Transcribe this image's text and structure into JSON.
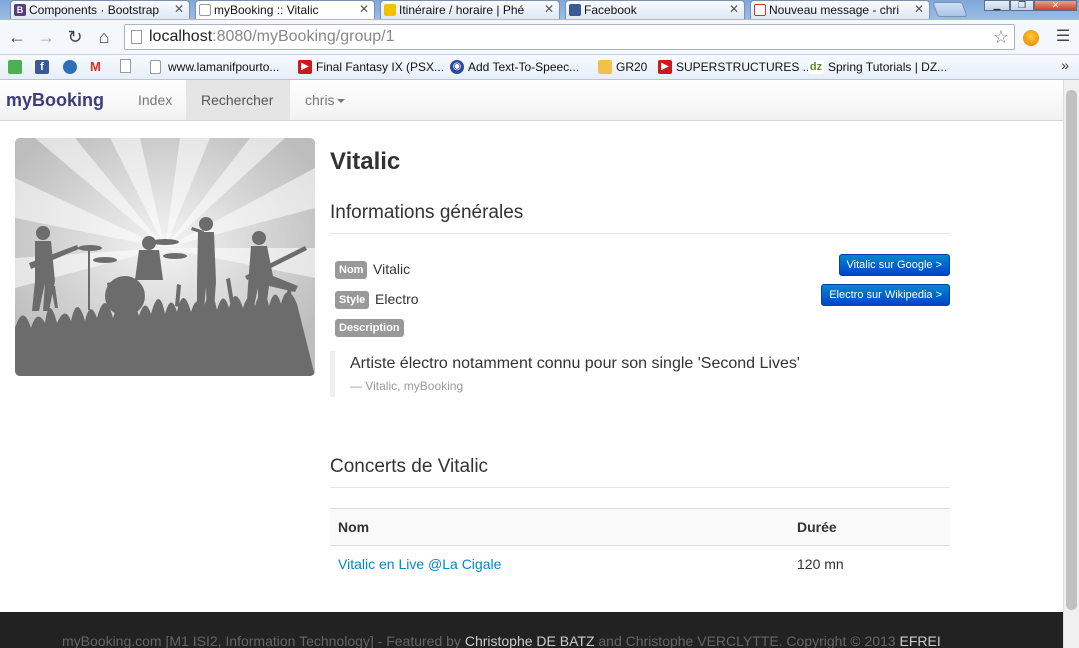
{
  "browser": {
    "tabs": [
      {
        "title": "Components · Bootstrap",
        "favicon_color": "#563d7c",
        "favicon_letter": "B"
      },
      {
        "title": "myBooking :: Vitalic",
        "favicon_color": "#ffffff"
      },
      {
        "title": "Itinéraire / horaire | Phé",
        "favicon_color": "#f2c200"
      },
      {
        "title": "Facebook",
        "favicon_color": "#3b5998"
      },
      {
        "title": "Nouveau message - chri",
        "favicon_color": "#d93025"
      }
    ],
    "address": {
      "host": "localhost",
      "rest": ":8080/myBooking/group/1"
    },
    "bookmarks": [
      {
        "label": "www.lamanifpourto...",
        "icon": "page-icon",
        "color": "#ffffff"
      },
      {
        "label": "Final Fantasy IX (PSX...",
        "icon": "youtube-icon",
        "color": "#cc181e"
      },
      {
        "label": "Add Text-To-Speec...",
        "icon": "app-icon",
        "color": "#2b4a9e"
      },
      {
        "label": "GR20",
        "icon": "folder-icon",
        "color": "#f1c24b"
      },
      {
        "label": "SUPERSTRUCTURES ...",
        "icon": "youtube-icon",
        "color": "#cc181e"
      },
      {
        "label": "Spring Tutorials | DZ...",
        "icon": "dzone-icon",
        "color": "#ffffff"
      }
    ]
  },
  "navbar": {
    "brand": "myBooking",
    "links": [
      "Index",
      "Rechercher"
    ],
    "user": "chris"
  },
  "group": {
    "name": "Vitalic",
    "info_heading": "Informations générales",
    "fields": {
      "nom_label": "Nom",
      "nom_value": "Vitalic",
      "style_label": "Style",
      "style_value": "Electro",
      "description_label": "Description"
    },
    "google_button": "Vitalic sur Google >",
    "wikipedia_button": "Electro sur Wikipedia >",
    "quote": "Artiste électro notamment connu pour son single 'Second Lives'",
    "quote_source": "— Vitalic, myBooking"
  },
  "concerts": {
    "heading": "Concerts de Vitalic",
    "columns": [
      "Nom",
      "Durée"
    ],
    "rows": [
      {
        "name": "Vitalic en Live @La Cigale",
        "duration": "120 mn"
      }
    ]
  },
  "footer": {
    "prefix": "myBooking.com [M1 ISI2, Information Technology] - Featured by ",
    "author1": "Christophe DE BATZ",
    "middle": " and Christophe VERCLYTTE. Copyright © 2013 ",
    "school": "EFREI"
  },
  "colors": {
    "accent": "#0088cc",
    "brand": "#3d3d7a",
    "footer_bg": "#222222"
  }
}
